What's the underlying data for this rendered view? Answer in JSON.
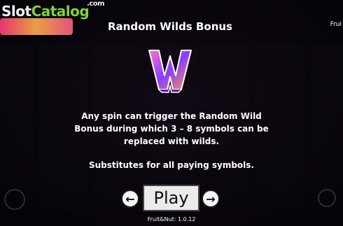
{
  "watermark": {
    "part1": "Slot",
    "part2": "Catalog",
    "suffix": ".com"
  },
  "header": {
    "title": "Random Wilds Bonus",
    "corner_label": "Frui"
  },
  "info": {
    "description": "Any spin can trigger the Random Wild\nBonus during which 3 – 8 symbols can be\nreplaced with wilds.",
    "substitutes": "Substitutes for all paying symbols."
  },
  "navigation": {
    "prev_icon": "arrow-left-icon",
    "next_icon": "arrow-right-icon",
    "prev_glyph": "←",
    "next_glyph": "→",
    "play_label": "Play"
  },
  "footer": {
    "version": "Fruit&Nut: 1.0.12"
  },
  "colors": {
    "accent_green": "#7fd13b",
    "wild_purple": "#8a3cff",
    "wild_pink": "#ff4fa8",
    "button_bg": "#ebebeb"
  }
}
